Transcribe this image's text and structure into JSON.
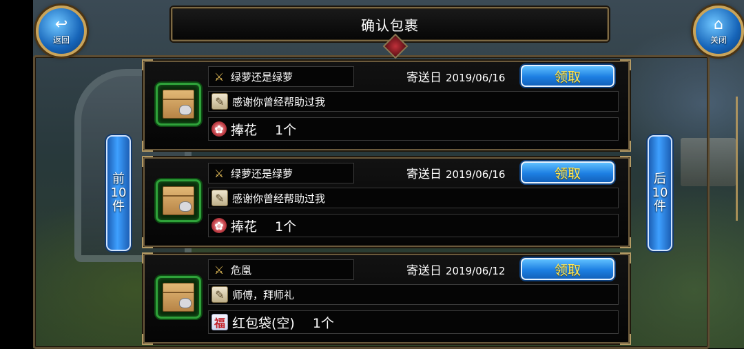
{
  "header": {
    "title": "确认包裹",
    "back_label": "返回",
    "back_icon": "↩",
    "close_label": "关闭",
    "close_icon": "⌂"
  },
  "nav": {
    "prev": [
      "前",
      "10",
      "件"
    ],
    "next": [
      "后",
      "10",
      "件"
    ]
  },
  "parcels": [
    {
      "sender": "绿萝还是绿萝",
      "date_label": "寄送日",
      "date": "2019/06/16",
      "claim_label": "领取",
      "message": "感谢你曾经帮助过我",
      "item_name": "捧花",
      "item_qty": "1个",
      "item_icon": "gift-icon"
    },
    {
      "sender": "绿萝还是绿萝",
      "date_label": "寄送日",
      "date": "2019/06/16",
      "claim_label": "领取",
      "message": "感谢你曾经帮助过我",
      "item_name": "捧花",
      "item_qty": "1个",
      "item_icon": "gift-icon"
    },
    {
      "sender": "危凰",
      "date_label": "寄送日",
      "date": "2019/06/12",
      "claim_label": "领取",
      "message": "师傅，拜师礼",
      "item_name": "红包袋(空)",
      "item_qty": "1个",
      "item_icon": "red-envelope-icon"
    }
  ],
  "colors": {
    "accent_blue": "#1d7fe2",
    "claim_text": "#ffe95a",
    "frame_gold": "#6b5a3c",
    "package_green": "#2fa23a"
  }
}
